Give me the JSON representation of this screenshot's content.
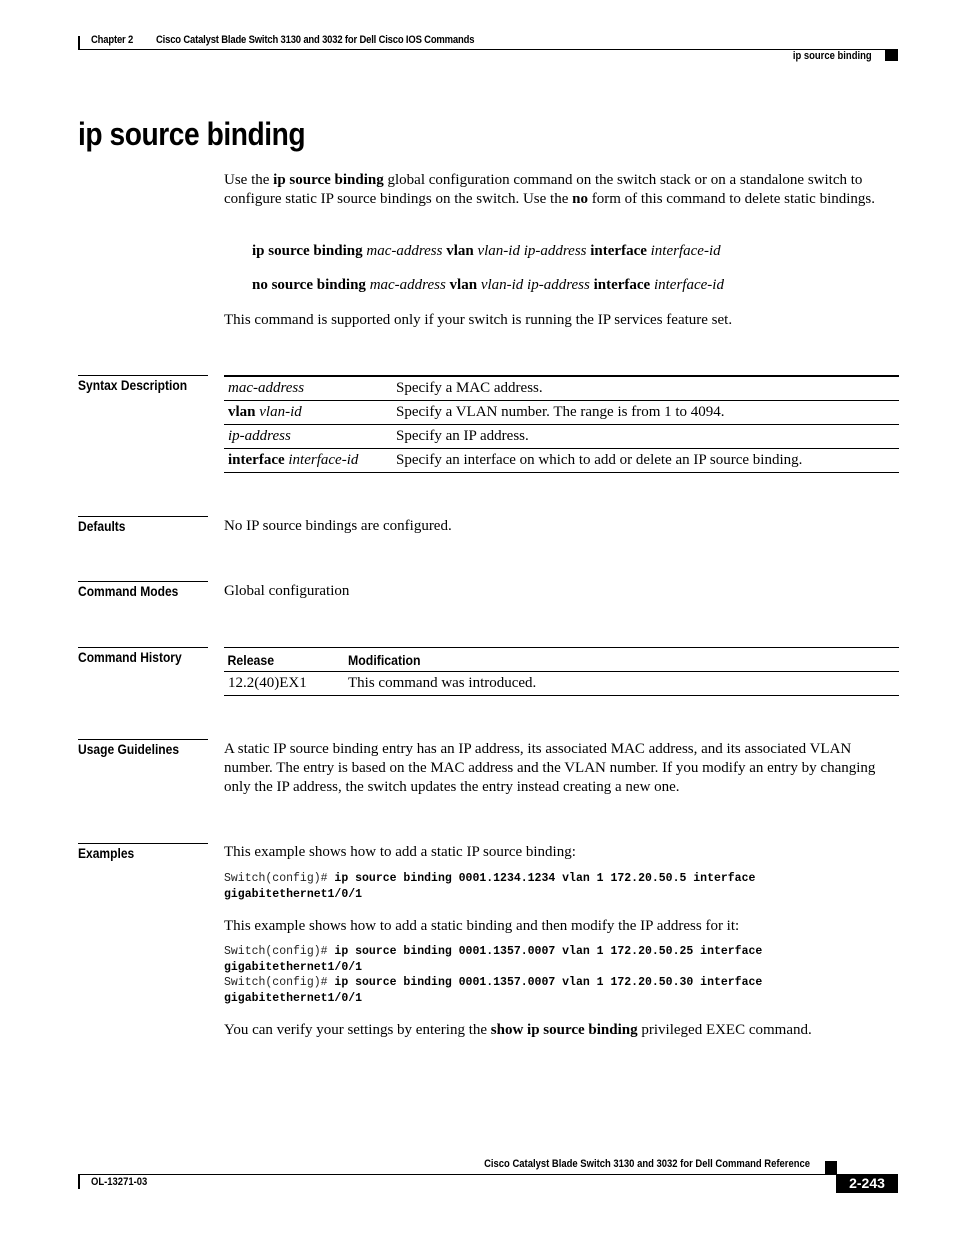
{
  "header": {
    "chapter": "Chapter 2",
    "book_title": "Cisco Catalyst Blade Switch 3130 and 3032 for Dell Cisco IOS Commands",
    "running_title": "ip source binding"
  },
  "title": "ip source binding",
  "intro": {
    "pre": "Use the ",
    "cmd": "ip source binding",
    "mid": " global configuration command on the switch stack or on a standalone switch to configure static IP source bindings on the switch. Use the ",
    "no": "no",
    "post": " form of this command to delete static bindings."
  },
  "syntax": [
    {
      "b1": "ip source binding",
      "i1": "mac-address",
      "b2": "vlan",
      "i2": "vlan-id ip-address",
      "b3": "interface",
      "i3": "interface-id"
    },
    {
      "b1": "no source binding",
      "i1": "mac-address",
      "b2": "vlan",
      "i2": "vlan-id ip-address",
      "b3": "interface",
      "i3": "interface-id"
    }
  ],
  "support_note": "This command is supported only if your switch is running the IP services feature set.",
  "sections": {
    "syntax_description": "Syntax Description",
    "defaults": "Defaults",
    "command_modes": "Command Modes",
    "command_history": "Command History",
    "usage_guidelines": "Usage Guidelines",
    "examples": "Examples"
  },
  "syntax_table": [
    {
      "keyword": "",
      "arg": "mac-address",
      "desc": "Specify a MAC address."
    },
    {
      "keyword": "vlan",
      "arg": "vlan-id",
      "desc": "Specify a VLAN number. The range is from 1 to 4094."
    },
    {
      "keyword": "",
      "arg": "ip-address",
      "desc": "Specify an IP address."
    },
    {
      "keyword": "interface",
      "arg": "interface-id",
      "desc": "Specify an interface on which to add or delete an IP source binding."
    }
  ],
  "defaults_text": "No IP source bindings are configured.",
  "command_modes_text": "Global configuration",
  "history": {
    "headers": [
      "Release",
      "Modification"
    ],
    "rows": [
      {
        "release": "12.2(40)EX1",
        "modification": "This command was introduced."
      }
    ]
  },
  "usage_text": "A static IP source binding entry has an IP address, its associated MAC address, and its associated VLAN number. The entry is based on the MAC address and the VLAN number. If you modify an entry by changing only the IP address, the switch updates the entry instead creating a new one.",
  "examples": {
    "intro1": "This example shows how to add a static IP source binding:",
    "code1": [
      {
        "prompt": "Switch(config)# ",
        "cmd": "ip source binding 0001.1234.1234 vlan 1 172.20.50.5 interface"
      },
      {
        "prompt": "",
        "cmd": "gigabitethernet1/0/1"
      }
    ],
    "intro2": "This example shows how to add a static binding and then modify the IP address for it:",
    "code2": [
      {
        "prompt": "Switch(config)# ",
        "cmd": "ip source binding 0001.1357.0007 vlan 1 172.20.50.25 interface"
      },
      {
        "prompt": "",
        "cmd": "gigabitethernet1/0/1"
      },
      {
        "prompt": "Switch(config)# ",
        "cmd": "ip source binding 0001.1357.0007 vlan 1 172.20.50.30 interface"
      },
      {
        "prompt": "",
        "cmd": "gigabitethernet1/0/1"
      }
    ],
    "verify_pre": "You can verify your settings by entering the ",
    "verify_cmd": "show ip source binding",
    "verify_post": " privileged EXEC command."
  },
  "footer": {
    "book_title": "Cisco Catalyst Blade Switch 3130 and 3032 for Dell Command Reference",
    "doc_number": "OL-13271-03",
    "page_number": "2-243"
  }
}
